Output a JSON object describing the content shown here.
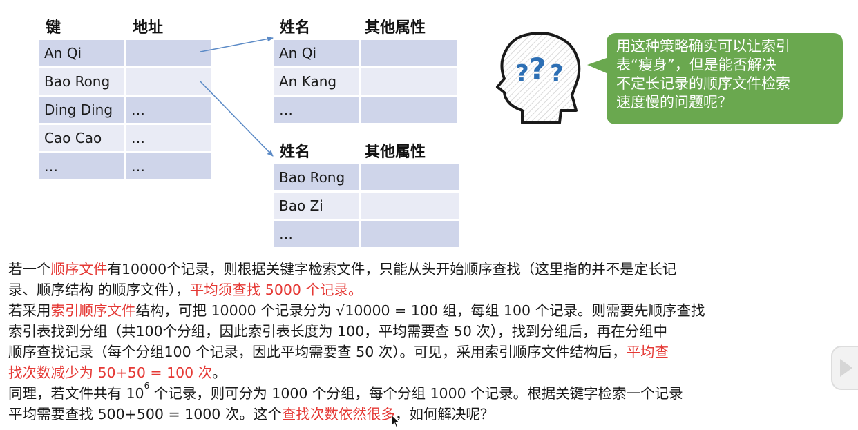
{
  "index_table": {
    "headers": [
      "键",
      "地址"
    ],
    "rows": [
      [
        "An Qi",
        ""
      ],
      [
        "Bao Rong",
        ""
      ],
      [
        "Ding Ding",
        "…"
      ],
      [
        "Cao Cao",
        "…"
      ],
      [
        "…",
        "…"
      ]
    ]
  },
  "group_table_1": {
    "headers": [
      "姓名",
      "其他属性"
    ],
    "rows": [
      [
        "An Qi",
        ""
      ],
      [
        "An Kang",
        ""
      ],
      [
        "…",
        ""
      ]
    ]
  },
  "group_table_2": {
    "headers": [
      "姓名",
      "其他属性"
    ],
    "rows": [
      [
        "Bao Rong",
        ""
      ],
      [
        "Bao Zi",
        ""
      ],
      [
        "…",
        ""
      ]
    ]
  },
  "bubble": {
    "lines": [
      "用这种策略确实可以让索引",
      "表“瘦身”，但是能否解决",
      "不定长记录的顺序文件检索",
      "速度慢的问题呢？"
    ],
    "color": "#6aa84f"
  },
  "paragraph": {
    "p1_a": "若一个",
    "p1_b": "顺序文件",
    "p1_c": "有10000个记录，则根据关键字检索文件，只能从头开始顺序查找（这里指的并不是定长记",
    "p1_d": "录、顺序结构 的顺序文件），",
    "p1_e": "平均须查找 5000 个记录。",
    "p2_a": "若采用",
    "p2_b": "索引顺序文件",
    "p2_c": "结构，可把 10000 个记录分为 √10000 = 100  组，每组 100 个记录。则需要先顺序查找",
    "p2_d": "索引表找到分组（共100个分组，因此索引表长度为 100，平均需要查 50 次），找到分组后，再在分组中",
    "p2_e": "顺序查找记录（每个分组100 个记录，因此平均需要查 50 次）。可见，采用索引顺序文件结构后，",
    "p2_f": "平均查",
    "p2_g": "找次数减少为 50+50 = 100 次",
    "p2_h": "。",
    "p3_a": "同理，若文件共有 10",
    "p3_sup": "6",
    "p3_b": " 个记录，则可分为 1000 个分组，每个分组 1000 个记录。根据关键字检索一个记录",
    "p3_c": "平均需要查找 500+500 = 1000 次。这个",
    "p3_d": "查找次数依然很多",
    "p3_e": "，如何解决呢？"
  },
  "colors": {
    "accent_red": "#e53935",
    "cell_dark": "#cfd5ea",
    "cell_light": "#e9ebf5",
    "arrow": "#5b8ac6"
  },
  "icons": [
    "thinking-head-icon",
    "play-button-icon",
    "mouse-cursor-icon"
  ]
}
